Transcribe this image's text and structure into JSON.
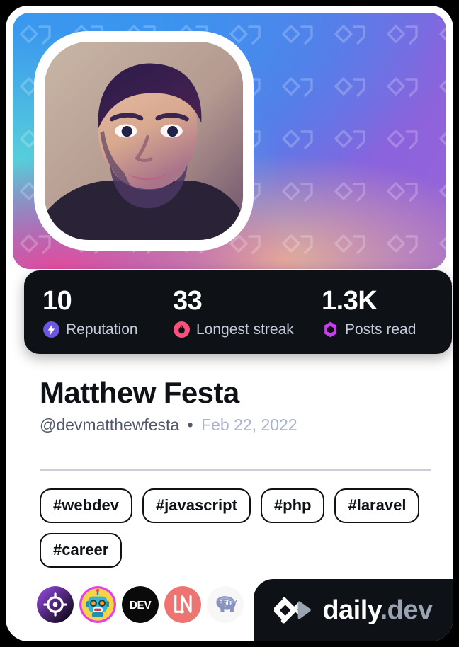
{
  "card": {
    "kind": "devcard",
    "background_color": "#000000",
    "frame_color": "#ffffff"
  },
  "cover": {
    "pattern_icon": "daily-dev-chevron-watermark",
    "gradient_from": "#3d9fe8",
    "gradient_mid": "#6373e6",
    "gradient_to": "#ec4899"
  },
  "avatar": {
    "icon": "user-portrait",
    "alt": "Matthew Festa profile photo"
  },
  "stats": [
    {
      "value": "10",
      "label": "Reputation",
      "icon": "bolt-icon",
      "color": "#6e57e0"
    },
    {
      "value": "33",
      "label": "Longest streak",
      "icon": "flame-icon",
      "color": "#f8517c"
    },
    {
      "value": "1.3K",
      "label": "Posts read",
      "icon": "ring-icon",
      "color": "#cd3df0"
    }
  ],
  "identity": {
    "name": "Matthew Festa",
    "handle": "@devmatthewfesta",
    "separator": "•",
    "joined": "Feb 22, 2022"
  },
  "tags": [
    {
      "label": "#webdev"
    },
    {
      "label": "#javascript"
    },
    {
      "label": "#php"
    },
    {
      "label": "#laravel"
    },
    {
      "label": "#career"
    }
  ],
  "badges": [
    {
      "name": "target-badge",
      "icon": "crosshair-icon",
      "color": "#a435f0"
    },
    {
      "name": "robot-badge",
      "icon": "robot-avatar-icon",
      "color": "#f5d547"
    },
    {
      "name": "dev-badge",
      "icon": "dev-logo-icon",
      "label": "DEV",
      "color": "#0a0a0a"
    },
    {
      "name": "ln-badge",
      "icon": "ln-logo-icon",
      "label": "LN",
      "color": "#ed7471"
    },
    {
      "name": "php-badge",
      "icon": "elephpant-icon",
      "color": "#8892be"
    }
  ],
  "logo": {
    "mark": "daily-dev-chevron-logo",
    "word": "daily",
    "suffix": ".dev",
    "plate_color": "#0e1217"
  }
}
